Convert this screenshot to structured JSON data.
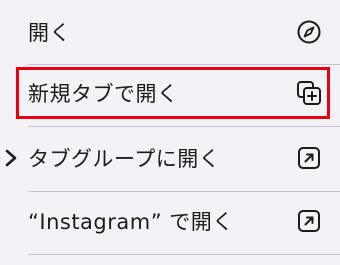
{
  "menu": {
    "items": [
      {
        "label": "開く",
        "icon": "compass-icon"
      },
      {
        "label": "新規タブで開く",
        "icon": "new-tab-icon"
      },
      {
        "label": "タブグループに開く",
        "icon": "arrow-up-right-square-icon",
        "has_submenu": true
      },
      {
        "label": "“Instagram” で開く",
        "icon": "arrow-up-right-square-icon"
      }
    ],
    "highlight_color": "#e60012"
  }
}
